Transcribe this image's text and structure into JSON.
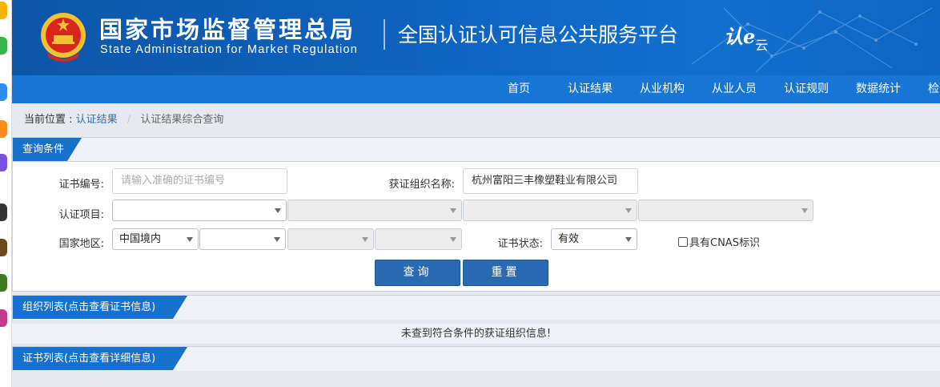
{
  "header": {
    "agency_cn": "国家市场监督管理总局",
    "agency_en": "State Administration  for  Market Regulation",
    "platform_title": "全国认证认可信息公共服务平台",
    "platform_logo_main": "认e",
    "platform_logo_sub": "云",
    "emblem_icon": "national-emblem-icon"
  },
  "nav": {
    "items": [
      "首页",
      "认证结果",
      "从业机构",
      "从业人员",
      "认证规则",
      "数据统计",
      "检"
    ]
  },
  "breadcrumb": {
    "prefix": "当前位置 :",
    "link": "认证结果",
    "separator": "/",
    "current": "认证结果综合查询"
  },
  "query": {
    "title": "查询条件",
    "cert_no_label": "证书编号:",
    "cert_no_placeholder": "请输入准确的证书编号",
    "org_name_label": "获证组织名称:",
    "org_name_value": "杭州富阳三丰橡塑鞋业有限公司",
    "project_label": "认证项目:",
    "region_label": "国家地区:",
    "region_value": "中国境内",
    "status_label": "证书状态:",
    "status_value": "有效",
    "cnas_label": "具有CNAS标识",
    "search_button": "查询",
    "reset_button": "重置"
  },
  "org_list": {
    "title": "组织列表(点击查看证书信息)",
    "empty_message": "未查到符合条件的获证组织信息!"
  },
  "cert_list": {
    "title": "证书列表(点击查看详细信息)"
  },
  "colors": {
    "banner_blue": "#0e63bf",
    "nav_blue": "#1776d4",
    "tag_blue": "#1670cc",
    "button_blue": "#2a6ab2"
  }
}
